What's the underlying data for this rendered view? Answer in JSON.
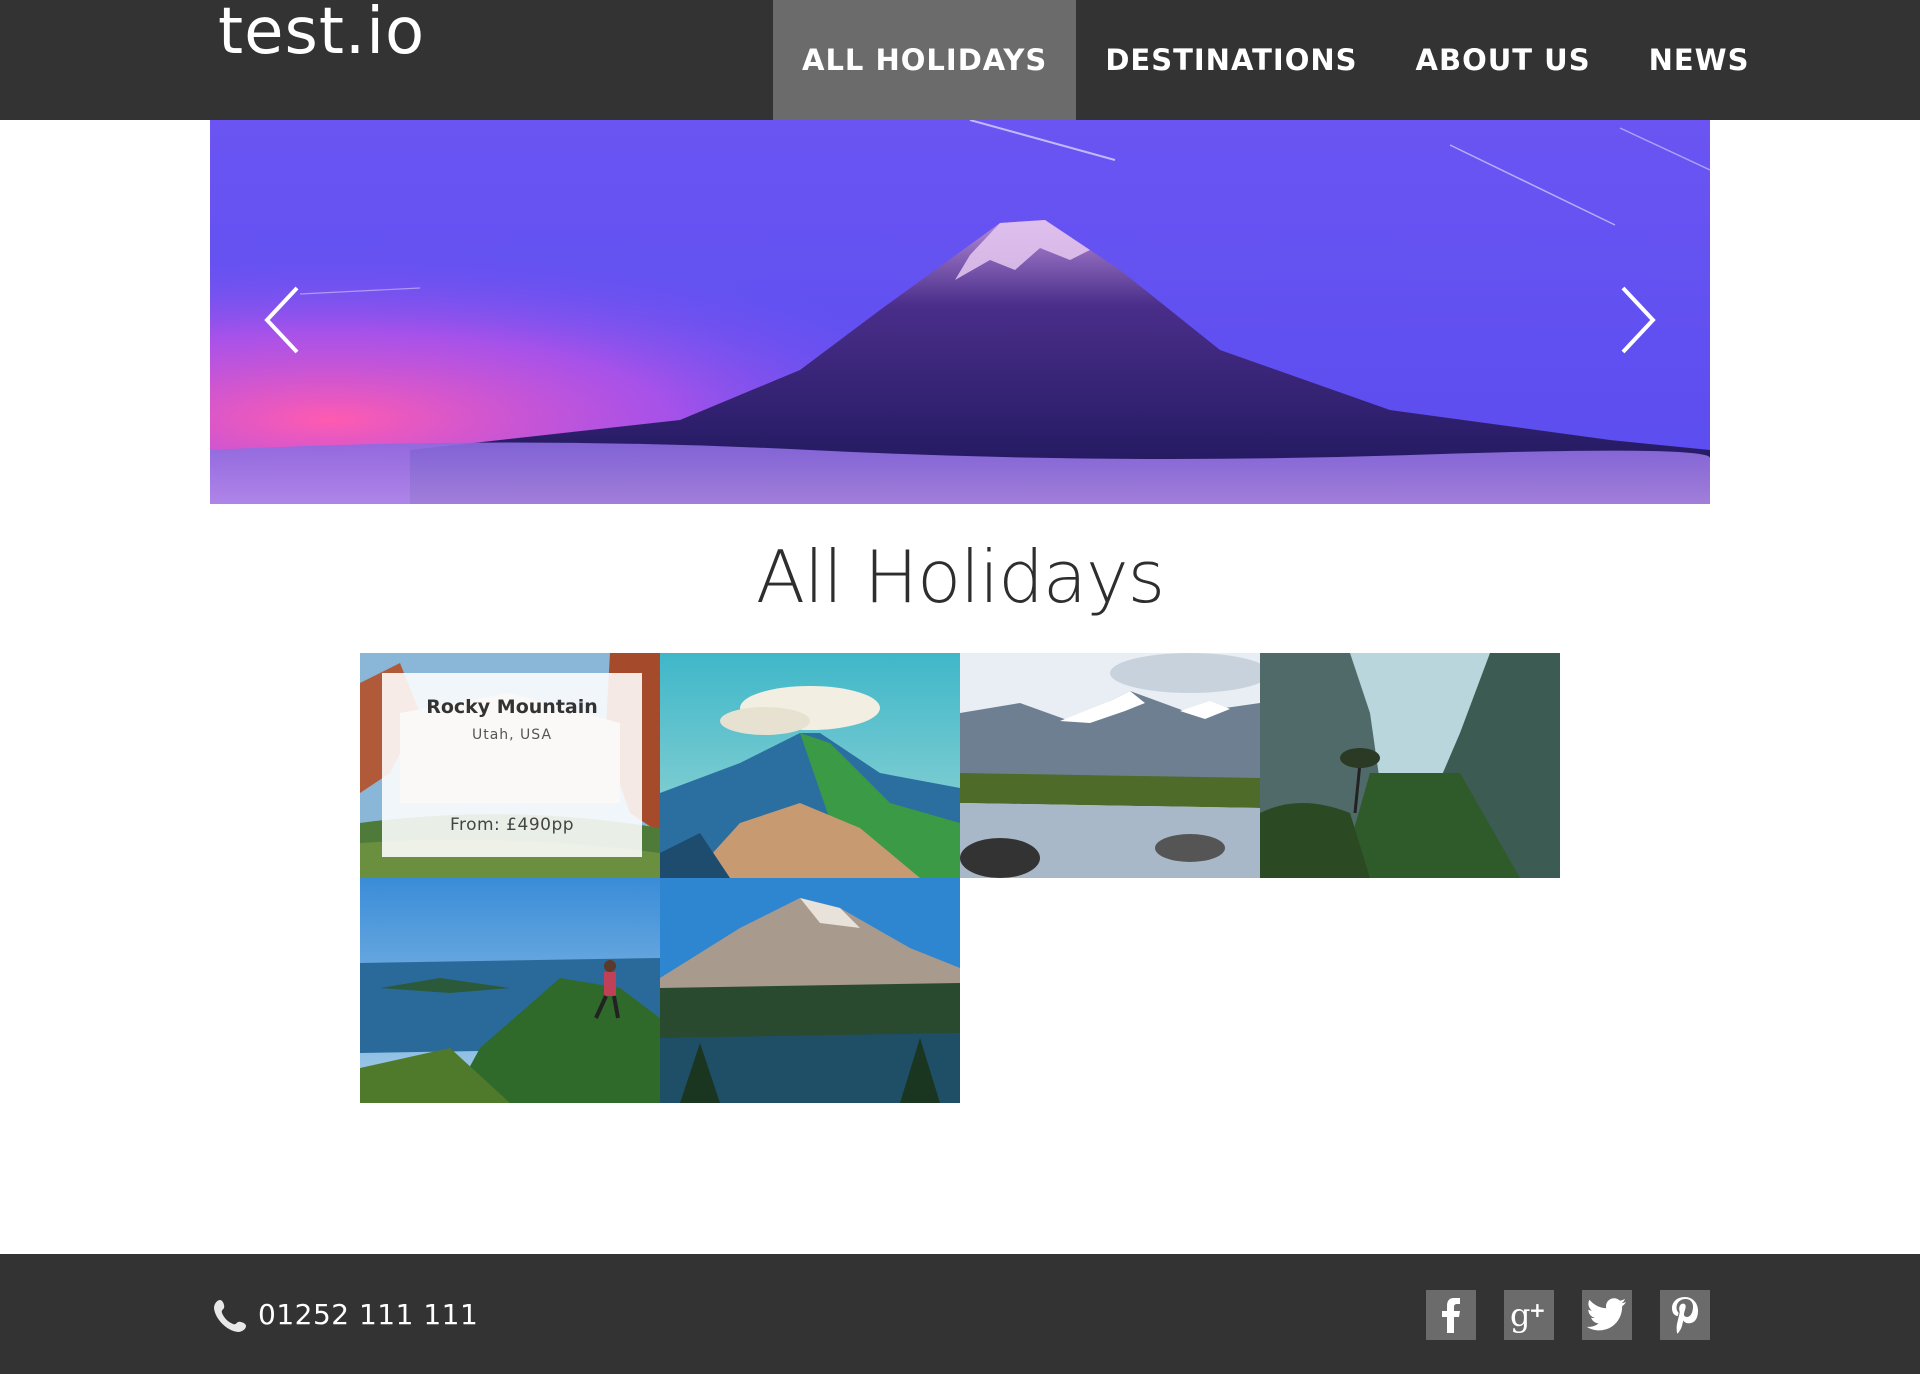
{
  "header": {
    "logo": "test.io",
    "nav": [
      {
        "label": "ALL HOLIDAYS",
        "active": true
      },
      {
        "label": "DESTINATIONS",
        "active": false
      },
      {
        "label": "ABOUT US",
        "active": false
      },
      {
        "label": "NEWS",
        "active": false
      }
    ]
  },
  "hero": {
    "slide_image": "mountain-at-dusk",
    "prev_icon": "chevron-left-icon",
    "next_icon": "chevron-right-icon"
  },
  "main": {
    "title": "All Holidays",
    "holidays": [
      {
        "image": "red-canyon",
        "title": "Rocky Mountain",
        "location": "Utah, USA",
        "price": "From: £490pp",
        "hovered": true
      },
      {
        "image": "green-ridge"
      },
      {
        "image": "snowy-valley-river"
      },
      {
        "image": "misty-gorge"
      },
      {
        "image": "hiker-over-lake"
      },
      {
        "image": "peak-over-forest-lake"
      }
    ]
  },
  "footer": {
    "phone_icon": "phone-icon",
    "phone": "01252 111 111",
    "social": [
      "facebook-icon",
      "google-plus-icon",
      "twitter-icon",
      "pinterest-icon"
    ]
  },
  "colors": {
    "header_bg": "#333333",
    "nav_active_bg": "#6b6b6b",
    "footer_bg": "#333333",
    "social_bg": "#6b6b6b"
  }
}
